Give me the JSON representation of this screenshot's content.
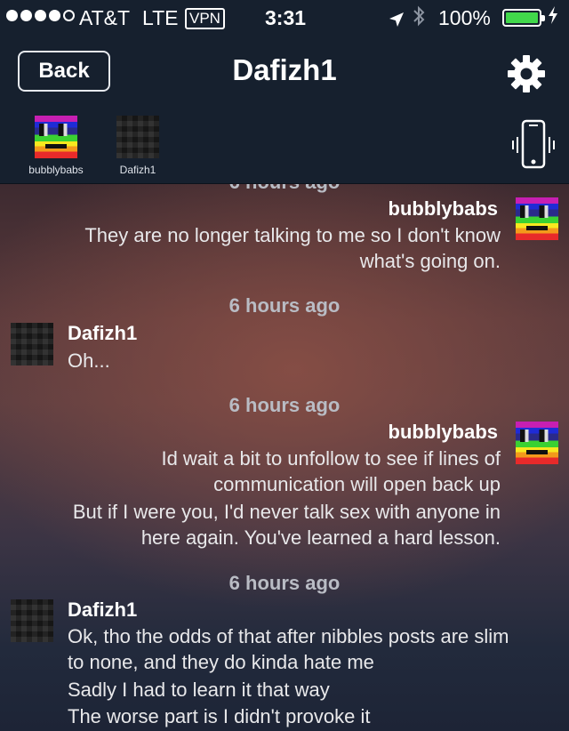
{
  "status_bar": {
    "carrier": "AT&T",
    "network": "LTE",
    "vpn": "VPN",
    "time": "3:31",
    "battery_percent": "100%"
  },
  "nav": {
    "back_label": "Back",
    "title": "Dafizh1"
  },
  "participants": [
    {
      "name": "bubblybabs"
    },
    {
      "name": "Dafizh1"
    }
  ],
  "messages": {
    "top_partial_timestamp": "6 hours ago",
    "groups": [
      {
        "sender": "bubblybabs",
        "side": "right",
        "lines": [
          "They are no longer talking to me so I don't know",
          "what's going on."
        ]
      },
      {
        "timestamp": "6 hours ago",
        "sender": "Dafizh1",
        "side": "left",
        "lines": [
          "Oh..."
        ]
      },
      {
        "timestamp": "6 hours ago",
        "sender": "bubblybabs",
        "side": "right",
        "lines": [
          "Id wait a bit to unfollow to see if lines of",
          "communication will open back up",
          "But if I were you, I'd never talk sex with anyone in",
          "here again.  You've learned a hard lesson."
        ]
      },
      {
        "timestamp": "6 hours ago",
        "sender": "Dafizh1",
        "side": "left",
        "lines": [
          "Ok, tho the odds of that after nibbles posts are slim",
          "to none, and they do kinda hate me",
          "Sadly I had to learn it that way",
          "The worse part is I didn't provoke it"
        ]
      }
    ]
  },
  "colors": {
    "battery_fill": "#41d84b",
    "header_background": "#16202e",
    "timestamp_text": "#b9bcc4"
  }
}
